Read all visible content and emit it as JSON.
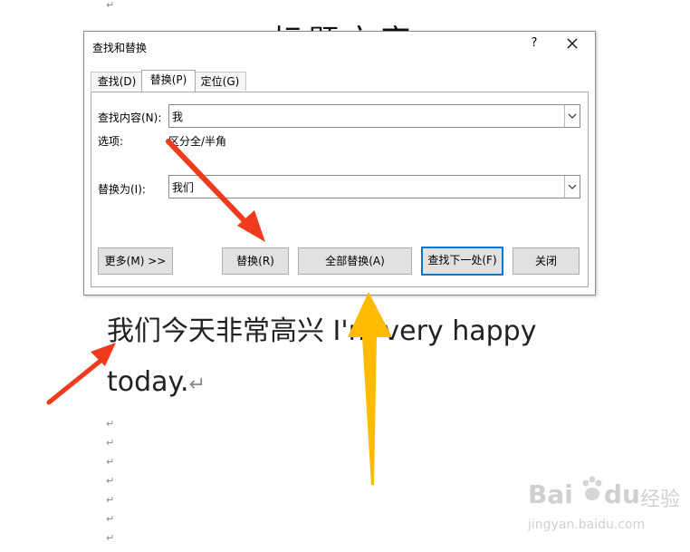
{
  "dialog": {
    "title": "查找和替换",
    "help": "?",
    "tabs": [
      {
        "label": "查找(D)"
      },
      {
        "label": "替换(P)"
      },
      {
        "label": "定位(G)"
      }
    ],
    "find_label": "查找内容(N):",
    "find_value": "我",
    "options_label": "选项:",
    "options_value": "区分全/半角",
    "replace_label": "替换为(I):",
    "replace_value": "我们",
    "buttons": {
      "more": "更多(M) >>",
      "replace": "替换(R)",
      "replace_all": "全部替换(A)",
      "find_next": "查找下一处(F)",
      "close": "关闭"
    }
  },
  "document": {
    "title_partial": "标题文字",
    "line1": "我们今天非常高兴 I'm very happy",
    "line2": "today.",
    "return_mark": "↵"
  },
  "watermark": {
    "brand": "Bai",
    "brand2": "du",
    "chinese": "经验",
    "url": "jingyan.baidu.com"
  },
  "colors": {
    "arrow_red": "#f03a1e",
    "arrow_yellow": "#ffbb00",
    "focus_blue": "#0078d7"
  }
}
